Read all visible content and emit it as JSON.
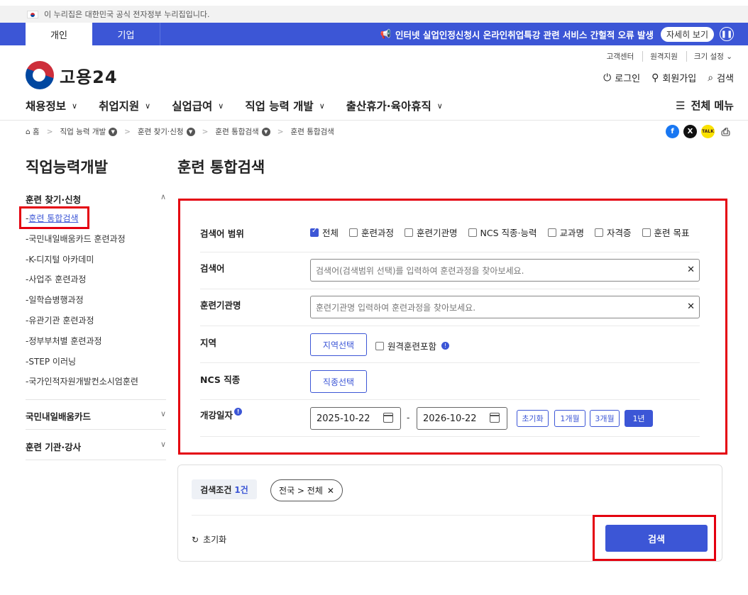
{
  "gov_notice": "이 누리집은 대한민국 공식 전자정부 누리집입니다.",
  "top_tabs": [
    "개인",
    "기업"
  ],
  "notice": {
    "text": "인터넷 실업인정신청시 온라인취업특강 관련 서비스 간헐적 오류 발생",
    "detail": "자세히 보기"
  },
  "util_links": [
    "고객센터",
    "원격지원",
    "크기 설정"
  ],
  "logo_text": "고용24",
  "user_actions": {
    "login": "로그인",
    "signup": "회원가입",
    "search": "검색"
  },
  "gnb": [
    "채용정보",
    "취업지원",
    "실업급여",
    "직업 능력 개발",
    "출산휴가·육아휴직"
  ],
  "all_menu": "전체 메뉴",
  "breadcrumb": [
    "홈",
    "직업 능력 개발",
    "훈련 찾기·신청",
    "훈련 통합검색",
    "훈련 통합검색"
  ],
  "sidebar": {
    "title": "직업능력개발",
    "group1": "훈련 찾기·신청",
    "items": [
      "훈련 통합검색",
      "국민내일배움카드 훈련과정",
      "K-디지털 아카데미",
      "사업주 훈련과정",
      "일학습병행과정",
      "유관기관 훈련과정",
      "정부부처별 훈련과정",
      "STEP 이러닝",
      "국가인적자원개발컨소시엄훈련"
    ],
    "group2": "국민내일배움카드",
    "group3": "훈련 기관·강사"
  },
  "main": {
    "title": "훈련 통합검색",
    "scope_label": "검색어 범위",
    "scope_options": [
      "전체",
      "훈련과정",
      "훈련기관명",
      "NCS 직종·능력",
      "교과명",
      "자격증",
      "훈련 목표"
    ],
    "keyword_label": "검색어",
    "keyword_placeholder": "검색어(검색범위 선택)를 입력하여 훈련과정을 찾아보세요.",
    "inst_label": "훈련기관명",
    "inst_placeholder": "훈련기관명 입력하여 훈련과정을 찾아보세요.",
    "region_label": "지역",
    "region_btn": "지역선택",
    "remote_label": "원격훈련포함",
    "ncs_label": "NCS 직종",
    "ncs_btn": "직종선택",
    "date_label": "개강일자",
    "date_from": "2025-10-22",
    "date_to": "2026-10-22",
    "date_sep": "-",
    "periods": [
      "초기화",
      "1개월",
      "3개월",
      "1년"
    ]
  },
  "summary": {
    "cond_label": "검색조건",
    "cond_count": "1건",
    "chip": "전국 > 전체",
    "reset": "초기화",
    "search": "검색"
  }
}
